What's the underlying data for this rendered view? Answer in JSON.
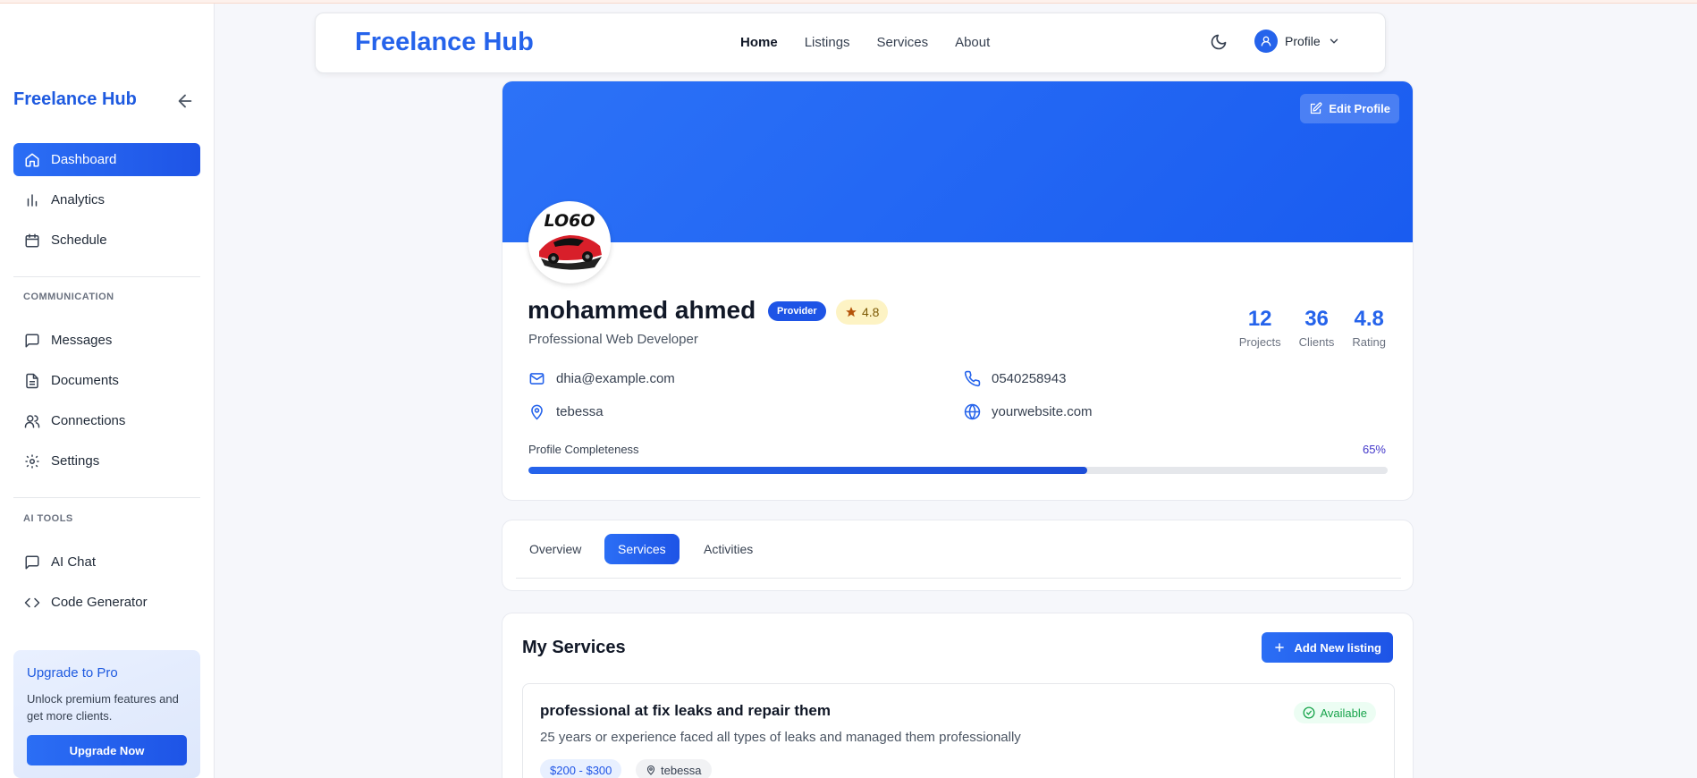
{
  "sidebar": {
    "brand": "Freelance Hub",
    "items_main": [
      {
        "label": "Dashboard",
        "icon": "home-icon",
        "active": true
      },
      {
        "label": "Analytics",
        "icon": "bar-chart-icon"
      },
      {
        "label": "Schedule",
        "icon": "calendar-icon"
      }
    ],
    "section_communication": "COMMUNICATION",
    "items_communication": [
      {
        "label": "Messages",
        "icon": "message-icon"
      },
      {
        "label": "Documents",
        "icon": "document-icon"
      },
      {
        "label": "Connections",
        "icon": "users-icon"
      },
      {
        "label": "Settings",
        "icon": "gear-icon"
      }
    ],
    "section_ai": "AI TOOLS",
    "items_ai": [
      {
        "label": "AI Chat",
        "icon": "message-icon"
      },
      {
        "label": "Code Generator",
        "icon": "code-icon"
      }
    ],
    "upgrade": {
      "title": "Upgrade to Pro",
      "text": "Unlock premium features and get more clients.",
      "button": "Upgrade Now"
    }
  },
  "topnav": {
    "brand": "Freelance Hub",
    "links": [
      "Home",
      "Listings",
      "Services",
      "About"
    ],
    "active_link": "Home",
    "profile_label": "Profile"
  },
  "profile": {
    "edit_label": "Edit Profile",
    "avatar_logo_text": "LO6O",
    "name": "mohammed ahmed",
    "role_badge": "Provider",
    "rating": "4.8",
    "title": "Professional Web Developer",
    "stats": [
      {
        "value": "12",
        "label": "Projects"
      },
      {
        "value": "36",
        "label": "Clients"
      },
      {
        "value": "4.8",
        "label": "Rating"
      }
    ],
    "email": "dhia@example.com",
    "phone": "0540258943",
    "location": "tebessa",
    "website": "yourwebsite.com",
    "completeness_label": "Profile Completeness",
    "completeness_text": "65%",
    "completeness_value": 0.65
  },
  "tabs": {
    "items": [
      "Overview",
      "Services",
      "Activities"
    ],
    "active": "Services"
  },
  "services": {
    "title": "My Services",
    "add_button": "Add New listing",
    "items": [
      {
        "name": "professional at fix leaks and repair them",
        "description": "25 years or experience faced all types of leaks and managed them professionally",
        "status": "Available",
        "price": "$200 - $300",
        "location": "tebessa"
      }
    ]
  },
  "colors": {
    "accent": "#2563eb",
    "cover": "#1a5cf0",
    "available": "#16a34a"
  }
}
